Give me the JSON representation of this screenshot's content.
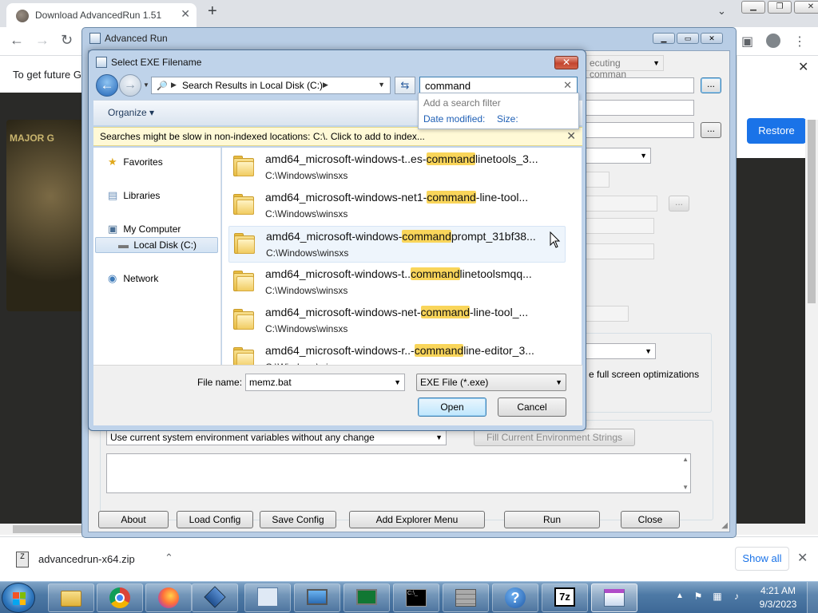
{
  "browser": {
    "tab_title": "Download AdvancedRun 1.51",
    "new_tab": "+",
    "page_text": "To get future G",
    "page_image_text": "MAJOR G",
    "restore_label": "Restore",
    "download_file": "advancedrun-x64.zip",
    "show_all": "Show all"
  },
  "advanced_run": {
    "title": "Advanced Run",
    "run_mode_fragment": "ecuting comman",
    "fullscreen_opt": "e full screen optimizations",
    "env_select": "Use current system environment variables without any change",
    "fill_env_btn": "Fill Current Environment Strings",
    "buttons": {
      "about": "About",
      "load_config": "Load Config",
      "save_config": "Save Config",
      "add_explorer_menu": "Add Explorer Menu",
      "run": "Run",
      "close": "Close"
    }
  },
  "dialog": {
    "title": "Select EXE Filename",
    "address_crumb": "Search Results in Local Disk (C:)",
    "search_query": "command",
    "search_hint": "Add a search filter",
    "filter_date": "Date modified:",
    "filter_size": "Size:",
    "organize": "Organize",
    "info_message": "Searches might be slow in non-indexed locations: C:\\. Click to add to index...",
    "nav": {
      "favorites": "Favorites",
      "libraries": "Libraries",
      "my_computer": "My Computer",
      "local_disk": "Local Disk (C:)",
      "network": "Network"
    },
    "files": [
      {
        "pre": "amd64_microsoft-windows-t..es-",
        "hl": "command",
        "post": "linetools_3...",
        "path": "C:\\Windows\\winsxs"
      },
      {
        "pre": "amd64_microsoft-windows-net1-",
        "hl": "command",
        "post": "-line-tool...",
        "path": "C:\\Windows\\winsxs"
      },
      {
        "pre": "amd64_microsoft-windows-",
        "hl": "command",
        "post": "prompt_31bf38...",
        "path": "C:\\Windows\\winsxs"
      },
      {
        "pre": "amd64_microsoft-windows-t..",
        "hl": "command",
        "post": "linetoolsmqq...",
        "path": "C:\\Windows\\winsxs"
      },
      {
        "pre": "amd64_microsoft-windows-net-",
        "hl": "command",
        "post": "-line-tool_...",
        "path": "C:\\Windows\\winsxs"
      },
      {
        "pre": "amd64_microsoft-windows-r..-",
        "hl": "command",
        "post": "line-editor_3...",
        "path": "C:\\Windows\\winsxs"
      }
    ],
    "file_name_label": "File name:",
    "file_name_value": "memz.bat",
    "file_type": "EXE File (*.exe)",
    "open": "Open",
    "cancel": "Cancel"
  },
  "taskbar": {
    "time": "4:21 AM",
    "date": "9/3/2023",
    "apps": [
      "explorer",
      "chrome",
      "firefox",
      "virtualbox",
      "control-panel",
      "computer",
      "task-manager",
      "cmd",
      "firewall",
      "help",
      "7zip",
      "advancedrun"
    ]
  },
  "colors": {
    "highlight": "#f9d55a",
    "chrome_blue": "#1a73e8",
    "taskbar": "#3d6896"
  }
}
